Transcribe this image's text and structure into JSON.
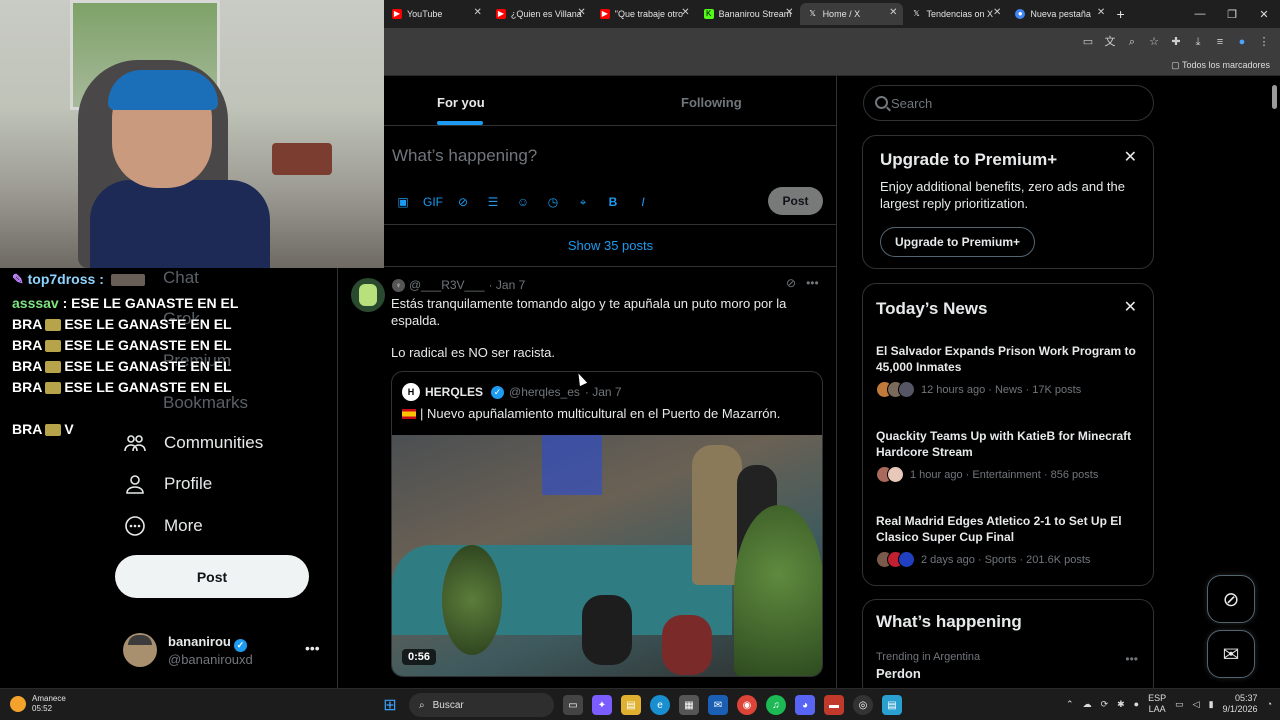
{
  "browser": {
    "tabs": [
      {
        "label": "YouTube",
        "fav_color": "#ff0000"
      },
      {
        "label": "¿Quien es Villana",
        "fav_color": "#ff0000"
      },
      {
        "label": "\"Que trabaje otro",
        "fav_color": "#ff0000"
      },
      {
        "label": "Bananirou Stream",
        "fav_color": "#53fc18"
      },
      {
        "label": "Home / X",
        "fav_color": "#000000",
        "active": true
      },
      {
        "label": "Tendencias on X",
        "fav_color": "#000000"
      },
      {
        "label": "Nueva pestaña",
        "fav_color": "#4285f4"
      }
    ],
    "bookmarks_all": "Todos los marcadores"
  },
  "stream_chat": {
    "header_user": "top7dross :",
    "user2": "asssav",
    "lines": [
      "ESE LE GANASTE EN EL",
      "BRA",
      "ESE LE GANASTE EN EL",
      "BRA",
      "ESE LE GANASTE EN EL",
      "BRA",
      "ESE LE GANASTE EN EL",
      "BRA",
      "ESE LE GANASTE EN EL",
      "BRA",
      "V"
    ]
  },
  "nav": {
    "faded": [
      "Chat",
      "Grok",
      "Premium",
      "Bookmarks"
    ],
    "communities": "Communities",
    "profile": "Profile",
    "more": "More",
    "post": "Post",
    "account_name": "bananirou",
    "account_handle": "@bananirouxd"
  },
  "home": {
    "tab_for_you": "For you",
    "tab_following": "Following",
    "composer_placeholder": "What’s happening?",
    "composer_post": "Post",
    "show_posts": "Show 35 posts"
  },
  "tweet": {
    "handle": "@___R3V___",
    "date": "· Jan 7",
    "text_line1": "Estás tranquilamente tomando algo y te apuñala un puto moro por la espalda.",
    "text_line2": "Lo radical es NO ser racista.",
    "quote": {
      "name": "HERQLES",
      "handle": "@herqles_es",
      "date": "· Jan 7",
      "text": "| Nuevo apuñalamiento multicultural en el Puerto de Mazarrón.",
      "duration": "0:56"
    }
  },
  "sidebar": {
    "search_placeholder": "Search",
    "premium": {
      "title": "Upgrade to Premium+",
      "desc": "Enjoy additional benefits, zero ads and the largest reply prioritization.",
      "button": "Upgrade to Premium+"
    },
    "news": {
      "title": "Today’s News",
      "items": [
        {
          "headline": "El Salvador Expands Prison Work Program to 45,000 Inmates",
          "meta": "12 hours ago · News · 17K posts"
        },
        {
          "headline": "Quackity Teams Up with KatieB for Minecraft Hardcore Stream",
          "meta": "1 hour ago · Entertainment · 856 posts"
        },
        {
          "headline": "Real Madrid Edges Atletico 2-1 to Set Up El Clasico Super Cup Final",
          "meta": "2 days ago · Sports · 201.6K posts"
        }
      ]
    },
    "happening": {
      "title": "What’s happening",
      "sub": "Trending in Argentina",
      "name": "Perdon"
    }
  },
  "taskbar": {
    "weather_title": "Amanece",
    "weather_time": "05:52",
    "search": "Buscar",
    "lang1": "ESP",
    "lang2": "LAA",
    "time": "05:37",
    "date": "9/1/2026"
  },
  "colors": {
    "accent": "#1d9bf0",
    "background": "#000000",
    "border": "#2f3336"
  }
}
